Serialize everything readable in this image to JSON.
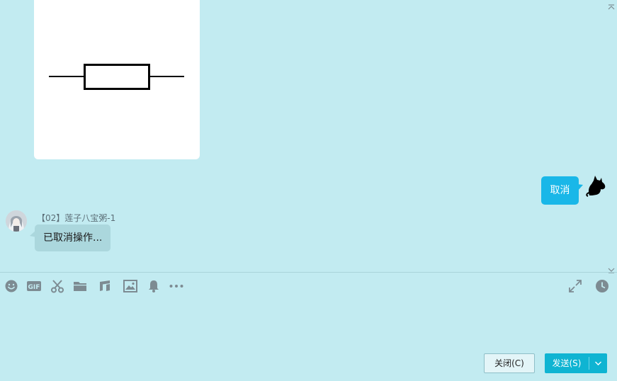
{
  "chat": {
    "outgoing_message": "取消",
    "incoming_sender": "【02】莲子八宝粥-1",
    "incoming_message": "已取消操作..."
  },
  "toolbar": {
    "icons": [
      "emoji-icon",
      "gif-icon",
      "screenshot-scissors-icon",
      "folder-icon",
      "music-note-icon",
      "image-icon",
      "bell-icon",
      "more-icon"
    ],
    "right_icons": [
      "fullscreen-icon",
      "history-clock-icon"
    ]
  },
  "buttons": {
    "close_label": "关闭(C)",
    "send_label": "发送(S)"
  },
  "colors": {
    "background": "#c2ebf1",
    "self_bubble": "#19b7e8",
    "other_bubble": "#abd7dd",
    "send_button": "#0fb4d2",
    "icon_gray": "#7d8b92"
  }
}
